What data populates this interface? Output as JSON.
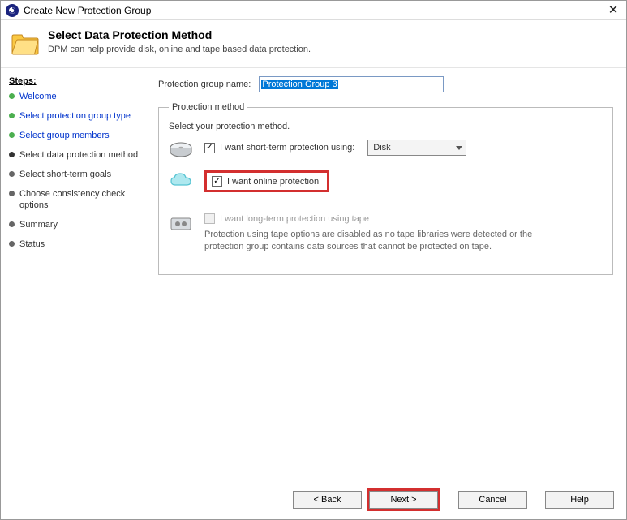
{
  "window": {
    "title": "Create New Protection Group",
    "close": "✕"
  },
  "header": {
    "title": "Select Data Protection Method",
    "subtitle": "DPM can help provide disk, online and tape based data protection."
  },
  "sidebar": {
    "title": "Steps:",
    "items": [
      {
        "label": "Welcome",
        "state": "completed",
        "link": true
      },
      {
        "label": "Select protection group type",
        "state": "completed",
        "link": true
      },
      {
        "label": "Select group members",
        "state": "completed",
        "link": true
      },
      {
        "label": "Select data protection method",
        "state": "active",
        "link": false
      },
      {
        "label": "Select short-term goals",
        "state": "pending",
        "link": false
      },
      {
        "label": "Choose consistency check options",
        "state": "pending",
        "link": false
      },
      {
        "label": "Summary",
        "state": "pending",
        "link": false
      },
      {
        "label": "Status",
        "state": "pending",
        "link": false
      }
    ]
  },
  "form": {
    "group_name_label": "Protection group name:",
    "group_name_value": "Protection Group 3",
    "method_legend": "Protection method",
    "method_instruction": "Select your protection method.",
    "short_term": {
      "label": "I want short-term protection using:",
      "checked": true,
      "select_value": "Disk"
    },
    "online": {
      "label": "I want online protection",
      "checked": true
    },
    "tape": {
      "label": "I want long-term protection using tape",
      "checked": false,
      "enabled": false,
      "desc": "Protection using tape options are disabled as no tape libraries were detected or the protection group contains data sources that cannot be protected on tape."
    }
  },
  "footer": {
    "back": "< Back",
    "next": "Next >",
    "cancel": "Cancel",
    "help": "Help"
  }
}
